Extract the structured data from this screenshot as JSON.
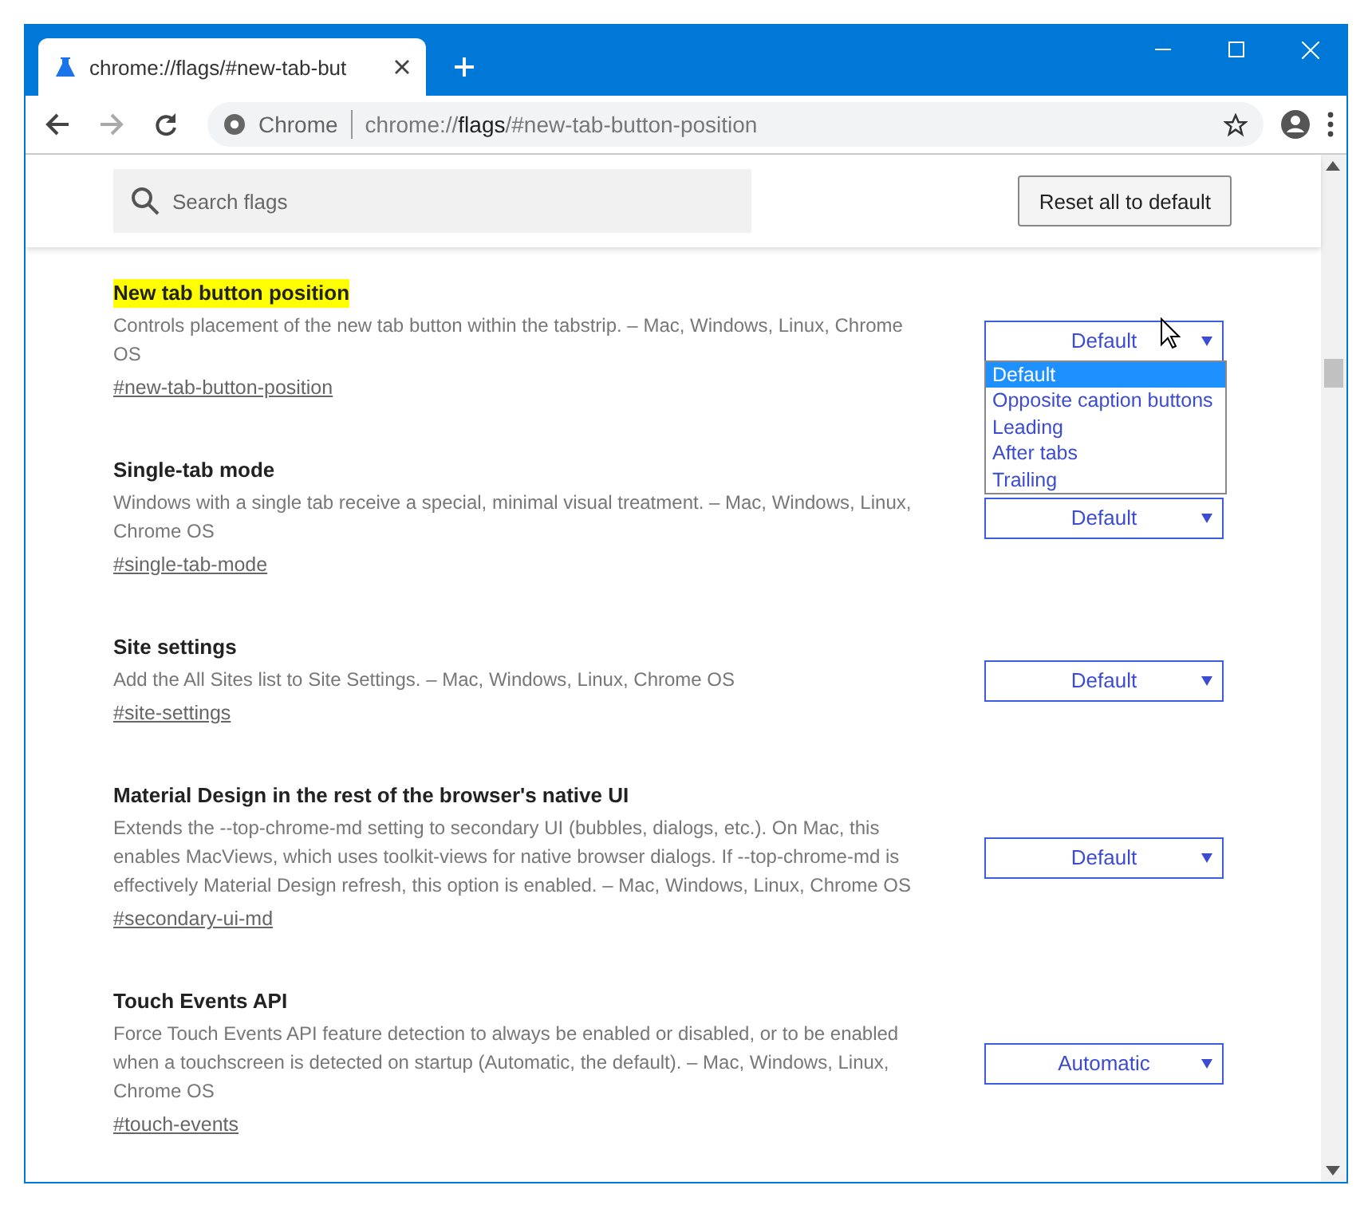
{
  "window": {
    "tab_title": "chrome://flags/#new-tab-but"
  },
  "toolbar": {
    "site_label": "Chrome",
    "address": {
      "scheme": "chrome://",
      "host": "flags",
      "path": "/#new-tab-button-position"
    }
  },
  "search": {
    "placeholder": "Search flags"
  },
  "reset_button": "Reset all to default",
  "flags": [
    {
      "title": "New tab button position",
      "highlighted": true,
      "description": "Controls placement of the new tab button within the tabstrip. – Mac, Windows, Linux, Chrome OS",
      "link": "#new-tab-button-position",
      "value": "Default",
      "options": [
        {
          "label": "Default",
          "selected": true
        },
        {
          "label": "Opposite caption buttons",
          "selected": false
        },
        {
          "label": "Leading",
          "selected": false
        },
        {
          "label": "After tabs",
          "selected": false
        },
        {
          "label": "Trailing",
          "selected": false
        }
      ]
    },
    {
      "title": "Single-tab mode",
      "highlighted": false,
      "description": "Windows with a single tab receive a special, minimal visual treatment. – Mac, Windows, Linux, Chrome OS",
      "link": "#single-tab-mode",
      "value": "Default"
    },
    {
      "title": "Site settings",
      "highlighted": false,
      "description": "Add the All Sites list to Site Settings. – Mac, Windows, Linux, Chrome OS",
      "link": "#site-settings",
      "value": "Default"
    },
    {
      "title": "Material Design in the rest of the browser's native UI",
      "highlighted": false,
      "description": "Extends the --top-chrome-md setting to secondary UI (bubbles, dialogs, etc.). On Mac, this enables MacViews, which uses toolkit-views for native browser dialogs. If --top-chrome-md is effectively Material Design refresh, this option is enabled. – Mac, Windows, Linux, Chrome OS",
      "link": "#secondary-ui-md",
      "value": "Default"
    },
    {
      "title": "Touch Events API",
      "highlighted": false,
      "description": "Force Touch Events API feature detection to always be enabled or disabled, or to be enabled when a touchscreen is detected on startup (Automatic, the default). – Mac, Windows, Linux, Chrome OS",
      "link": "#touch-events",
      "value": "Automatic"
    }
  ]
}
